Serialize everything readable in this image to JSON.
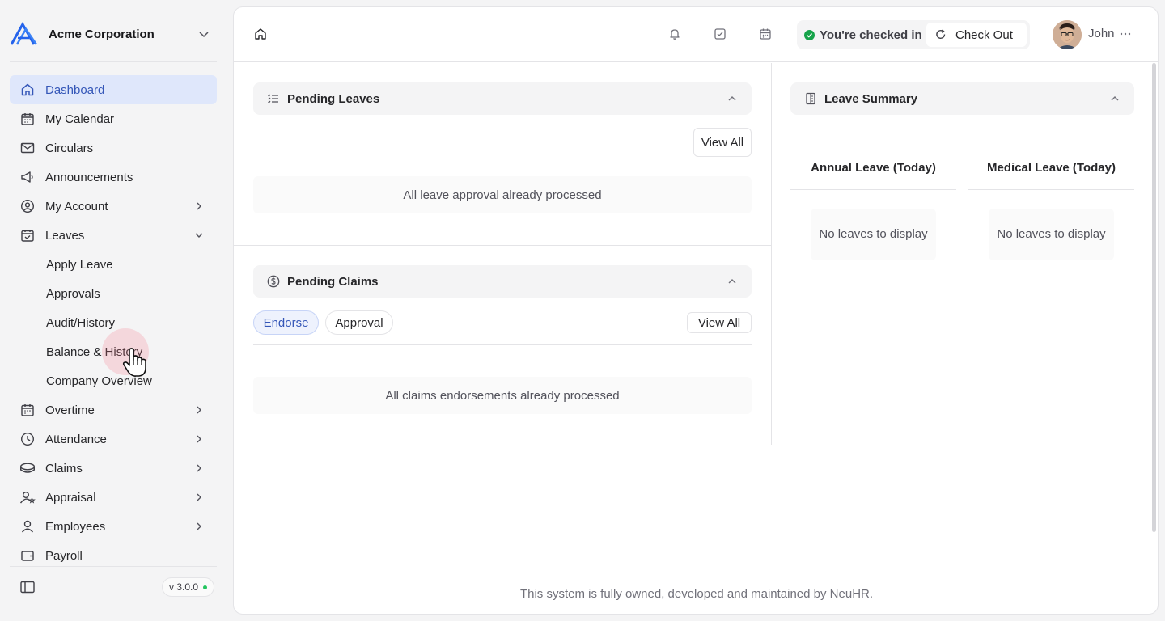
{
  "app": {
    "company_name": "Acme Corporation",
    "version": "v 3.0.0",
    "logo_icon": "mountain-logo",
    "accent_color": "#3557b8"
  },
  "sidebar": {
    "items": [
      {
        "label": "Dashboard",
        "icon": "home-icon",
        "active": true
      },
      {
        "label": "My Calendar",
        "icon": "calendar-icon"
      },
      {
        "label": "Circulars",
        "icon": "mail-icon"
      },
      {
        "label": "Announcements",
        "icon": "megaphone-icon"
      },
      {
        "label": "My Account",
        "icon": "user-circle-icon",
        "has_children": true
      },
      {
        "label": "Leaves",
        "icon": "calendar-check-icon",
        "expanded": true
      },
      {
        "label": "Overtime",
        "icon": "calendar-clock-icon",
        "has_children": true
      },
      {
        "label": "Attendance",
        "icon": "clock-icon",
        "has_children": true
      },
      {
        "label": "Claims",
        "icon": "coins-icon",
        "has_children": true
      },
      {
        "label": "Appraisal",
        "icon": "user-star-icon",
        "has_children": true
      },
      {
        "label": "Employees",
        "icon": "user-icon",
        "has_children": true
      },
      {
        "label": "Payroll",
        "icon": "wallet-icon"
      }
    ],
    "leaves_children": [
      {
        "label": "Apply Leave"
      },
      {
        "label": "Approvals"
      },
      {
        "label": "Audit/History"
      },
      {
        "label": "Balance & History"
      },
      {
        "label": "Company Overview"
      }
    ]
  },
  "topbar": {
    "icons": [
      "home-icon",
      "bell-icon",
      "checkbox-icon",
      "calendar-icon"
    ],
    "checkin_status": "You're checked in",
    "checkout_label": "Check Out",
    "user_name": "John"
  },
  "pending_leaves": {
    "title": "Pending Leaves",
    "view_all": "View All",
    "empty_message": "All leave approval already processed"
  },
  "pending_claims": {
    "title": "Pending Claims",
    "tabs": [
      {
        "label": "Endorse",
        "active": true
      },
      {
        "label": "Approval",
        "active": false
      }
    ],
    "view_all": "View All",
    "empty_message": "All claims endorsements already processed"
  },
  "leave_summary": {
    "title": "Leave Summary",
    "columns": [
      {
        "title": "Annual Leave (Today)",
        "empty_message": "No leaves to display"
      },
      {
        "title": "Medical Leave (Today)",
        "empty_message": "No leaves to display"
      }
    ]
  },
  "footer": {
    "text": "This system is fully owned, developed and maintained by NeuHR."
  }
}
